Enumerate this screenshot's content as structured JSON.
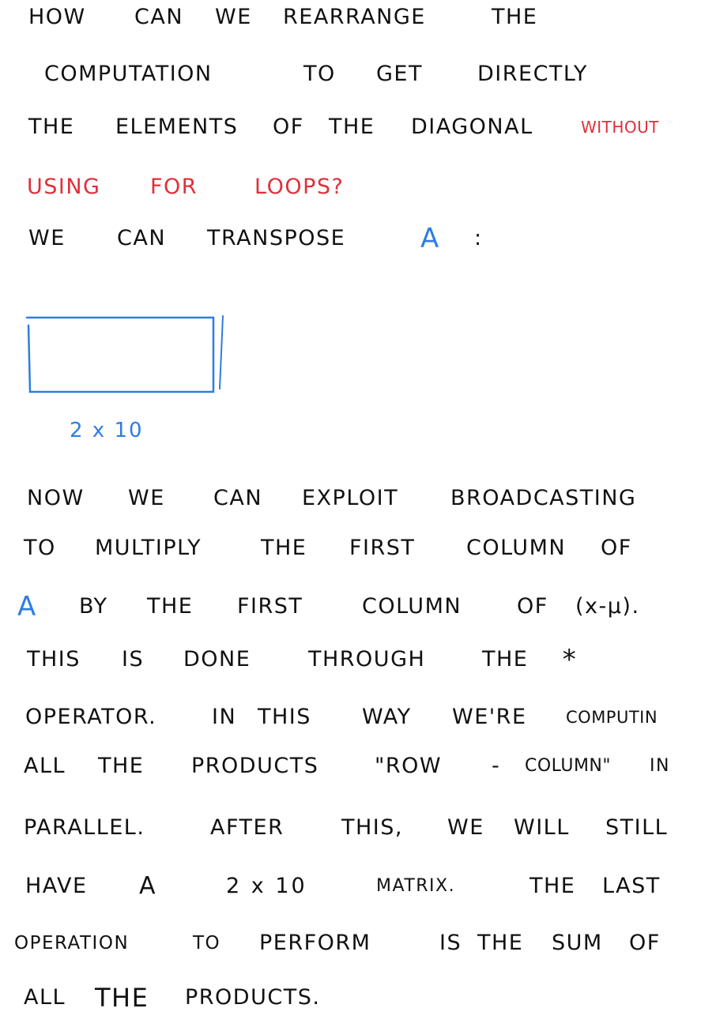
{
  "lines": [
    {
      "words": [
        "HOW",
        "CAN",
        "WE",
        "REARRANGE",
        "THE"
      ]
    },
    {
      "words": [
        "COMPUTATION",
        "TO",
        "GET",
        "DIRECTLY"
      ]
    },
    {
      "words": [
        "THE",
        "ELEMENTS",
        "OF",
        "THE",
        "DIAGONAL",
        "WITHOUT"
      ]
    },
    {
      "words": [
        "USING",
        "FOR",
        "LOOPS?"
      ]
    },
    {
      "words": [
        "WE",
        "CAN",
        "TRANSPOSE",
        "A",
        ":"
      ]
    },
    {
      "words": [
        "NOW",
        "WE",
        "CAN",
        "EXPLOIT",
        "BROADCASTING"
      ]
    },
    {
      "words": [
        "TO",
        "MULTIPLY",
        "THE",
        "FIRST",
        "COLUMN",
        "OF"
      ]
    },
    {
      "words": [
        "A",
        "BY",
        "THE",
        "FIRST",
        "COLUMN",
        "OF",
        "(x-μ)."
      ]
    },
    {
      "words": [
        "THIS",
        "IS",
        "DONE",
        "THROUGH",
        "THE",
        "*"
      ]
    },
    {
      "words": [
        "OPERATOR.",
        "IN",
        "THIS",
        "WAY",
        "WE'RE",
        "COMPUTIN"
      ]
    },
    {
      "words": [
        "ALL",
        "THE",
        "PRODUCTS",
        "\"ROW",
        "-",
        "COLUMN\"",
        "IN"
      ]
    },
    {
      "words": [
        "PARALLEL.",
        "AFTER",
        "THIS,",
        "WE",
        "WILL",
        "STILL"
      ]
    },
    {
      "words": [
        "HAVE",
        "A",
        "2 x 10",
        "MATRIX.",
        "THE",
        "LAST"
      ]
    },
    {
      "words": [
        "OPERATION",
        "TO",
        "PERFORM",
        "IS",
        "THE",
        "SUM",
        "OF"
      ]
    },
    {
      "words": [
        "ALL",
        "THE",
        "PRODUCTS."
      ]
    }
  ],
  "diagram": {
    "label": "2 x 10"
  },
  "colors": {
    "ink": "#111111",
    "red": "#e0303a",
    "blue": "#2f7de1",
    "background": "#ffffff"
  }
}
